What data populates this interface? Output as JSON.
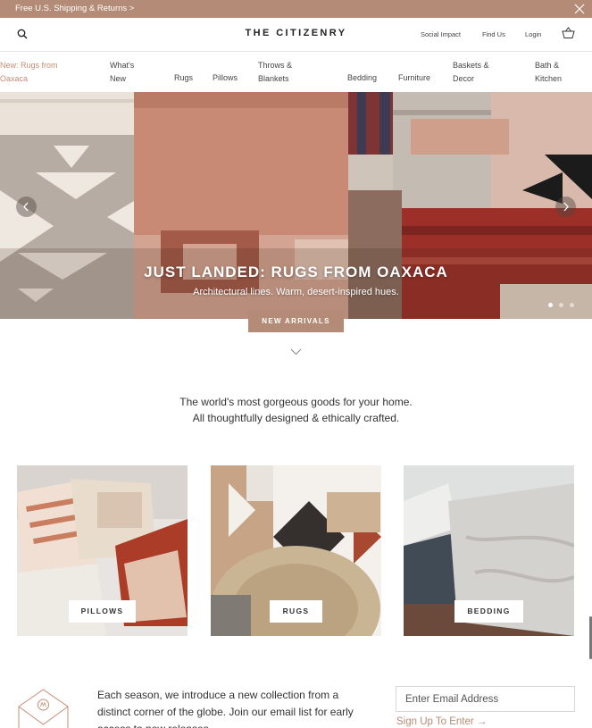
{
  "promo": {
    "text": "Free U.S. Shipping & Returns >"
  },
  "header": {
    "logo": "THE CITIZENRY",
    "links": {
      "social_impact": "Social Impact",
      "find_us": "Find Us",
      "login": "Login"
    }
  },
  "nav": {
    "items": [
      {
        "label": "New: Rugs from Oaxaca"
      },
      {
        "label": "What's New"
      },
      {
        "label": "Rugs"
      },
      {
        "label": "Pillows"
      },
      {
        "label": "Throws & Blankets"
      },
      {
        "label": "Bedding"
      },
      {
        "label": "Furniture"
      },
      {
        "label": "Baskets & Decor"
      },
      {
        "label": "Bath & Kitchen"
      }
    ]
  },
  "hero": {
    "title": "JUST LANDED: RUGS FROM OAXACA",
    "subtitle": "Architectural lines. Warm, desert-inspired hues.",
    "cta_label": "NEW ARRIVALS",
    "slide_count": 3,
    "active_slide": 1
  },
  "tagline": {
    "line1": "The world's most gorgeous goods for your home.",
    "line2": "All thoughtfully designed & ethically crafted."
  },
  "categories": [
    {
      "label": "PILLOWS"
    },
    {
      "label": "RUGS"
    },
    {
      "label": "BEDDING"
    }
  ],
  "newsletter": {
    "text": "Each season, we introduce a new collection from a distinct corner of the globe. Join our email list for early access to new releases.",
    "email_placeholder": "Enter Email Address",
    "signup_label": "Sign Up To Enter →"
  },
  "colors": {
    "accent": "#b48b76",
    "nav_accent": "#c58c74"
  },
  "icons": [
    "search-icon",
    "close-icon",
    "cart-icon",
    "chevron-left-icon",
    "chevron-right-icon",
    "chevron-down-icon",
    "envelope-icon"
  ]
}
